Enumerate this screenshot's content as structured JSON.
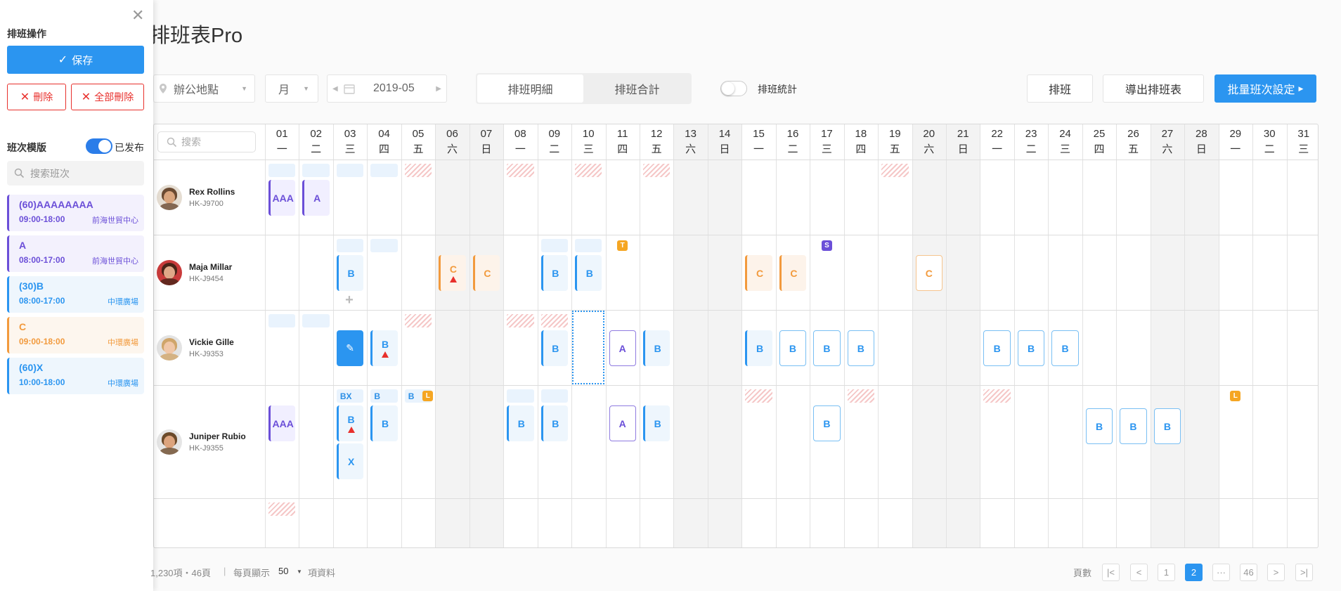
{
  "page_title": "排班表Pro",
  "toolbar": {
    "location_placeholder": "辦公地點",
    "period": "月",
    "month": "2019-05",
    "tab_detail": "排班明細",
    "tab_total": "排班合計",
    "stats_label": "排班統計",
    "btn_schedule": "排班",
    "btn_export": "導出排班表",
    "btn_batch": "批量班次設定"
  },
  "grid": {
    "search_placeholder": "搜索",
    "days": [
      {
        "d": "01",
        "w": "一"
      },
      {
        "d": "02",
        "w": "二"
      },
      {
        "d": "03",
        "w": "三"
      },
      {
        "d": "04",
        "w": "四"
      },
      {
        "d": "05",
        "w": "五"
      },
      {
        "d": "06",
        "w": "六"
      },
      {
        "d": "07",
        "w": "日"
      },
      {
        "d": "08",
        "w": "一"
      },
      {
        "d": "09",
        "w": "二"
      },
      {
        "d": "10",
        "w": "三"
      },
      {
        "d": "11",
        "w": "四"
      },
      {
        "d": "12",
        "w": "五"
      },
      {
        "d": "13",
        "w": "六"
      },
      {
        "d": "14",
        "w": "日"
      },
      {
        "d": "15",
        "w": "一"
      },
      {
        "d": "16",
        "w": "二"
      },
      {
        "d": "17",
        "w": "三"
      },
      {
        "d": "18",
        "w": "四"
      },
      {
        "d": "19",
        "w": "五"
      },
      {
        "d": "20",
        "w": "六"
      },
      {
        "d": "21",
        "w": "日"
      },
      {
        "d": "22",
        "w": "一"
      },
      {
        "d": "23",
        "w": "二"
      },
      {
        "d": "24",
        "w": "三"
      },
      {
        "d": "25",
        "w": "四"
      },
      {
        "d": "26",
        "w": "五"
      },
      {
        "d": "27",
        "w": "六"
      },
      {
        "d": "28",
        "w": "日"
      },
      {
        "d": "29",
        "w": "一"
      },
      {
        "d": "30",
        "w": "二"
      },
      {
        "d": "31",
        "w": "三"
      }
    ],
    "weekend_days": [
      6,
      7,
      13,
      14,
      20,
      21,
      27,
      28
    ],
    "employees": [
      {
        "name": "Rex Rollins",
        "id": "HK-J9700",
        "hair": "#6a4a32",
        "skin": "#d9a57e",
        "bg": "#e5ddd2"
      },
      {
        "name": "Maja Millar",
        "id": "HK-J9454",
        "hair": "#4a2418",
        "skin": "#e0a888",
        "bg": "#c93b3b"
      },
      {
        "name": "Vickie Gille",
        "id": "HK-J9353",
        "hair": "#cfa56a",
        "skin": "#f0c7a8",
        "bg": "#e3e3e3"
      },
      {
        "name": "Juniper Rubio",
        "id": "HK-J9355",
        "hair": "#6b4a2a",
        "skin": "#dca47e",
        "bg": "#e5e5e5"
      }
    ],
    "rows": [
      {
        "bands": [
          {
            "day": 1
          },
          {
            "day": 2
          },
          {
            "day": 3
          },
          {
            "day": 4
          }
        ],
        "hatch": [
          5,
          8,
          10,
          12,
          19
        ],
        "shifts": [
          {
            "day": 1,
            "code": "AAA",
            "style": "bar-p"
          },
          {
            "day": 2,
            "code": "A",
            "style": "bar-p"
          }
        ],
        "badges": []
      },
      {
        "bands": [
          {
            "day": 3
          },
          {
            "day": 4
          },
          {
            "day": 9
          },
          {
            "day": 10
          }
        ],
        "hatch": [],
        "shifts": [
          {
            "day": 3,
            "code": "B",
            "style": "bar-b"
          },
          {
            "day": 6,
            "code": "C",
            "style": "bar-c",
            "warn": true
          },
          {
            "day": 7,
            "code": "C",
            "style": "bar-c"
          },
          {
            "day": 9,
            "code": "B",
            "style": "bar-b"
          },
          {
            "day": 10,
            "code": "B",
            "style": "bar-b"
          },
          {
            "day": 15,
            "code": "C",
            "style": "bar-c"
          },
          {
            "day": 16,
            "code": "C",
            "style": "bar-c"
          },
          {
            "day": 20,
            "code": "C",
            "style": "out-c"
          }
        ],
        "badges": [
          {
            "day": 11,
            "text": "T",
            "color": "#f5a623",
            "pos": "c"
          },
          {
            "day": 17,
            "text": "S",
            "color": "#6b4fd8",
            "pos": "c"
          }
        ],
        "plus_day": 3
      },
      {
        "bands": [
          {
            "day": 1
          },
          {
            "day": 2
          }
        ],
        "hatch": [
          5,
          8,
          9
        ],
        "shifts": [
          {
            "day": 3,
            "code": "",
            "style": "edit",
            "edit": true
          },
          {
            "day": 4,
            "code": "B",
            "style": "bar-b",
            "warn": true
          },
          {
            "day": 9,
            "code": "B",
            "style": "bar-b"
          },
          {
            "day": 11,
            "code": "A",
            "style": "out-p"
          },
          {
            "day": 12,
            "code": "B",
            "style": "bar-b"
          },
          {
            "day": 15,
            "code": "B",
            "style": "bar-b"
          },
          {
            "day": 16,
            "code": "B",
            "style": "out-b"
          },
          {
            "day": 17,
            "code": "B",
            "style": "out-b"
          },
          {
            "day": 18,
            "code": "B",
            "style": "out-b"
          },
          {
            "day": 22,
            "code": "B",
            "style": "out-b"
          },
          {
            "day": 23,
            "code": "B",
            "style": "out-b"
          },
          {
            "day": 24,
            "code": "B",
            "style": "out-b"
          }
        ],
        "badges": [],
        "selected_day": 10
      },
      {
        "bands": [
          {
            "day": 3,
            "text": "BX"
          },
          {
            "day": 4,
            "text": "B"
          },
          {
            "day": 5,
            "text": "B"
          },
          {
            "day": 8
          },
          {
            "day": 9
          }
        ],
        "hatch": [
          15,
          18,
          22
        ],
        "shifts": [
          {
            "day": 1,
            "code": "AAA",
            "style": "bar-p"
          },
          {
            "day": 3,
            "code": "B",
            "style": "bar-b",
            "warn": true
          },
          {
            "day": 3,
            "code": "X",
            "style": "bar-b",
            "second": true
          },
          {
            "day": 4,
            "code": "B",
            "style": "bar-b"
          },
          {
            "day": 8,
            "code": "B",
            "style": "bar-b"
          },
          {
            "day": 9,
            "code": "B",
            "style": "bar-b"
          },
          {
            "day": 11,
            "code": "A",
            "style": "out-p"
          },
          {
            "day": 12,
            "code": "B",
            "style": "bar-b"
          },
          {
            "day": 17,
            "code": "B",
            "style": "out-b"
          },
          {
            "day": 25,
            "code": "B",
            "style": "out-b",
            "low": true
          },
          {
            "day": 26,
            "code": "B",
            "style": "out-b",
            "low": true
          },
          {
            "day": 27,
            "code": "B",
            "style": "out-b",
            "low": true
          }
        ],
        "badges": [
          {
            "day": 5,
            "text": "L",
            "color": "#f5a623",
            "pos": "r"
          },
          {
            "day": 29,
            "text": "L",
            "color": "#f5a623",
            "pos": "c"
          }
        ]
      },
      {
        "bands": [],
        "hatch": [
          1
        ],
        "shifts": [],
        "badges": []
      }
    ]
  },
  "panel": {
    "ops_title": "排班操作",
    "save": "保存",
    "delete": "刪除",
    "delete_all": "全部刪除",
    "tpl_title": "班次模版",
    "published": "已发布",
    "search_placeholder": "搜索班次",
    "templates": [
      {
        "name": "(60)AAAAAAAA",
        "time": "09:00-18:00",
        "loc": "前海世貿中心",
        "color": "#6b4fd8",
        "bg": "#f3f1fd"
      },
      {
        "name": "A",
        "time": "08:00-17:00",
        "loc": "前海世貿中心",
        "color": "#6b4fd8",
        "bg": "#f3f1fd"
      },
      {
        "name": "(30)B",
        "time": "08:00-17:00",
        "loc": "中環廣場",
        "color": "#2b95f0",
        "bg": "#eef6fd"
      },
      {
        "name": "C",
        "time": "09:00-18:00",
        "loc": "中環廣場",
        "color": "#f29a3d",
        "bg": "#fdf6ee"
      },
      {
        "name": "(60)X",
        "time": "10:00-18:00",
        "loc": "中環廣場",
        "color": "#2b95f0",
        "bg": "#eef6fd"
      }
    ]
  },
  "footer": {
    "total": "1,230項・46頁",
    "sep": "|",
    "per_page_label": "每頁顯示",
    "per_page": "50",
    "items_label": "項資料",
    "pages_label": "頁數",
    "first": "|<",
    "prev": "<",
    "page1": "1",
    "current": "2",
    "ellipsis": "···",
    "last_page": "46",
    "next": ">",
    "last": ">|"
  },
  "colors": {
    "accent": "#2b95f0",
    "danger": "#e8302c",
    "purple": "#6b4fd8",
    "orange": "#f29a3d"
  }
}
